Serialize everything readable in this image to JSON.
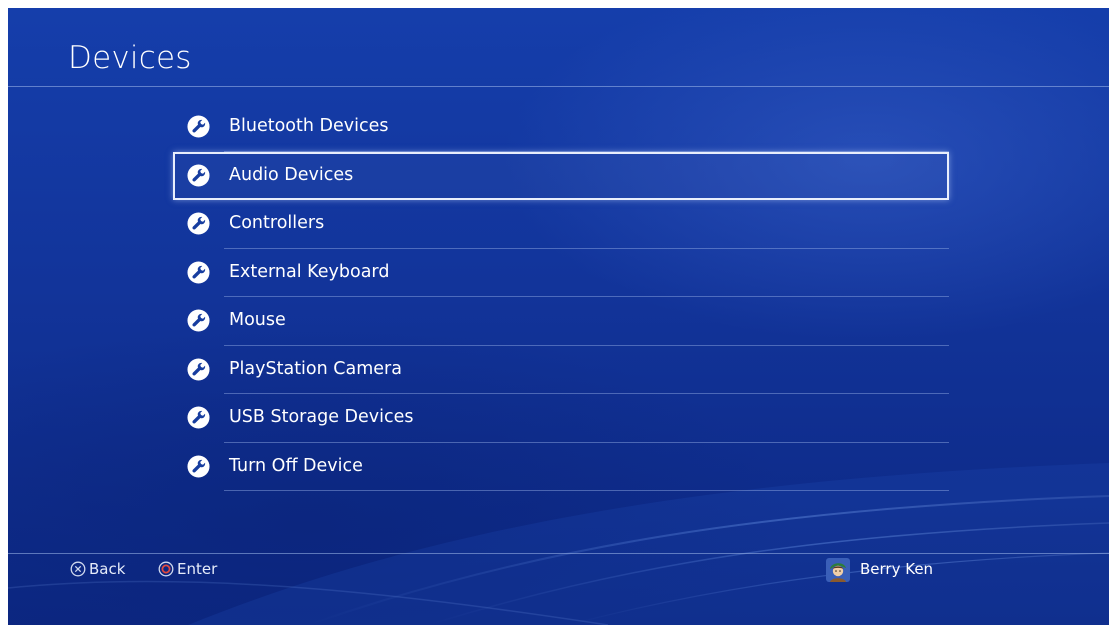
{
  "header": {
    "title": "Devices"
  },
  "menu": {
    "focused_index": 1,
    "items": [
      {
        "label": "Bluetooth Devices",
        "icon": "wrench-icon"
      },
      {
        "label": "Audio Devices",
        "icon": "wrench-icon"
      },
      {
        "label": "Controllers",
        "icon": "wrench-icon"
      },
      {
        "label": "External Keyboard",
        "icon": "wrench-icon"
      },
      {
        "label": "Mouse",
        "icon": "wrench-icon"
      },
      {
        "label": "PlayStation Camera",
        "icon": "wrench-icon"
      },
      {
        "label": "USB Storage Devices",
        "icon": "wrench-icon"
      },
      {
        "label": "Turn Off Device",
        "icon": "wrench-icon"
      }
    ]
  },
  "footer": {
    "back_label": "Back",
    "back_icon": "cross-button-icon",
    "enter_label": "Enter",
    "enter_icon": "circle-button-icon",
    "user_name": "Berry Ken",
    "user_icon": "avatar"
  },
  "colors": {
    "background": "#12349a",
    "focus_border": "#e8eefc",
    "text": "#ffffff",
    "circle_button": "#d0403a"
  }
}
